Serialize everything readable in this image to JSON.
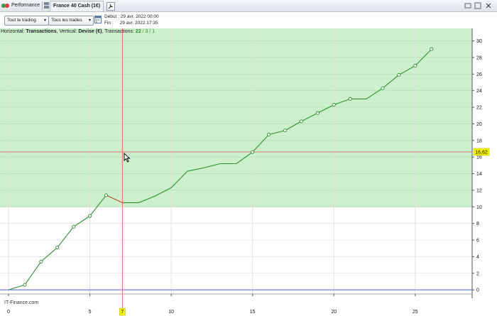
{
  "window": {
    "tab_performance": "Performance",
    "instrument": "France 40 Cash (1€)"
  },
  "toolbar": {
    "trading_dropdown": "Tout le trading",
    "trades_dropdown": "Tous les trades",
    "start_label": "Début :",
    "start_value": "29 avr. 2022 00:00",
    "end_label": "Fin :",
    "end_value": "29 avr. 2022 17:35"
  },
  "info": {
    "horizontal_label": "Horizontal:",
    "horizontal_value": "Transactions",
    "vertical_label": "Vertical:",
    "vertical_value": "Devise (€)",
    "transactions_label": "Transactions:",
    "transactions_total": "22",
    "transactions_rest": "/ 3 / 1"
  },
  "watermark": "IT-Finance.com",
  "colors": {
    "profit_zone": "#cdf0cc",
    "line_up": "#2f8f2f",
    "line_down": "#b03a2e",
    "crosshair": "#e06666",
    "zero_line": "#4d5fd6",
    "highlight": "#f2f200"
  },
  "chart_data": {
    "type": "line",
    "x": [
      0,
      1,
      2,
      3,
      4,
      5,
      6,
      7,
      8,
      9,
      10,
      11,
      12,
      13,
      14,
      15,
      16,
      17,
      18,
      19,
      20,
      21,
      22,
      23,
      24,
      25,
      26
    ],
    "y": [
      0,
      0.6,
      3.4,
      5.1,
      7.6,
      8.9,
      11.4,
      10.5,
      10.5,
      11.3,
      12.3,
      14.3,
      14.7,
      15.2,
      15.2,
      16.6,
      18.7,
      19.2,
      20.3,
      21.3,
      22.3,
      23.0,
      23.0,
      24.3,
      25.9,
      27.0,
      29.0
    ],
    "markers_on_x": [
      1,
      2,
      3,
      4,
      5,
      6,
      15,
      16,
      17,
      18,
      19,
      20,
      21,
      23,
      24,
      25,
      26
    ],
    "down_segments": [
      [
        6,
        7
      ]
    ],
    "xlim": [
      0,
      28.5
    ],
    "ylim": [
      -0.5,
      31.5
    ],
    "x_ticks": [
      0,
      5,
      10,
      15,
      20,
      25
    ],
    "y_ticks": [
      0,
      2,
      4,
      6,
      8,
      10,
      12,
      14,
      16,
      18,
      20,
      22,
      24,
      26,
      28,
      30
    ],
    "shaded_above": 10,
    "crosshair_x": 7,
    "crosshair_y": 16.62,
    "crosshair_x_label": "7",
    "crosshair_y_label": "16,62",
    "grid": true
  }
}
